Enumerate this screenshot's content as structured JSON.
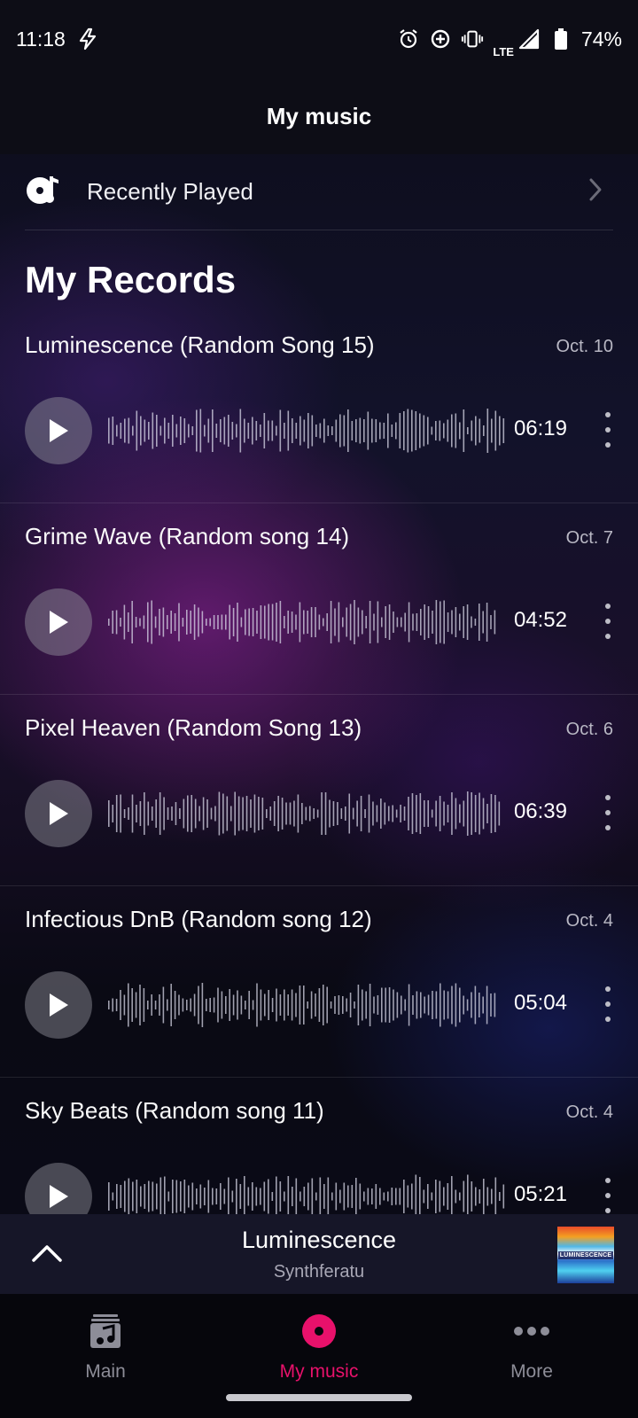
{
  "status_bar": {
    "time": "11:18",
    "network": "LTE",
    "battery": "74%"
  },
  "header": {
    "title": "My music"
  },
  "recently_played": {
    "label": "Recently Played"
  },
  "section": {
    "title": "My Records"
  },
  "records": [
    {
      "title": "Luminescence (Random Song 15)",
      "date": "Oct. 10",
      "duration": "06:19"
    },
    {
      "title": "Grime Wave (Random song 14)",
      "date": "Oct. 7",
      "duration": "04:52"
    },
    {
      "title": "Pixel Heaven (Random Song 13)",
      "date": "Oct. 6",
      "duration": "06:39"
    },
    {
      "title": "Infectious DnB (Random song 12)",
      "date": "Oct. 4",
      "duration": "05:04"
    },
    {
      "title": "Sky Beats (Random song 11)",
      "date": "Oct. 4",
      "duration": "05:21"
    }
  ],
  "now_playing": {
    "title": "Luminescence",
    "artist": "Synthferatu",
    "art_text": "LUMINESCENCE"
  },
  "nav": {
    "items": [
      {
        "label": "Main",
        "icon": "music-note-icon"
      },
      {
        "label": "My music",
        "icon": "record-icon"
      },
      {
        "label": "More",
        "icon": "more-horizontal-icon"
      }
    ],
    "active_index": 1
  },
  "colors": {
    "accent": "#e8116b",
    "nav_inactive": "#8d8d98"
  }
}
